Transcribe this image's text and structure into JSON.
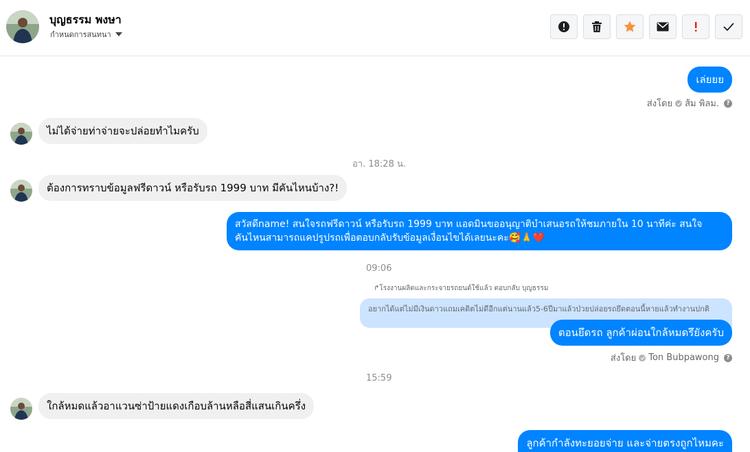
{
  "header": {
    "contact_name": "บุญธรรม พงษา",
    "subtitle": "กำหนดการสนทนา",
    "actions": [
      {
        "icon": "alert-circle-icon",
        "label": "report"
      },
      {
        "icon": "trash-icon",
        "label": "delete"
      },
      {
        "icon": "star-icon",
        "label": "star"
      },
      {
        "icon": "envelope-icon",
        "label": "mark-unread"
      },
      {
        "icon": "exclamation-icon",
        "label": "important"
      },
      {
        "icon": "checkmark-icon",
        "label": "done"
      }
    ]
  },
  "messages": [
    {
      "dir": "out",
      "text": "เล่ยยย"
    },
    {
      "sent_by_label": "ส่งโดย",
      "sent_by_name": "ส้ม พิลม."
    },
    {
      "dir": "in",
      "text": "ไม่ได้จ่ายท่าจ่ายจะปล่อยทำไมครับ"
    },
    {
      "timestamp": "อา. 18:28 น."
    },
    {
      "dir": "in",
      "text": "ต้องการทราบข้อมูลฟรีดาวน์ หรือรับรถ 1999 บาท มีคันไหนบ้าง?!"
    },
    {
      "dir": "out",
      "text_line1": "สวัสดีname! สนใจรถฟรีดาวน์ หรือรับรถ 1999 บาท แอดมินขออนุญาติบำเสนอรถให้ชมภายใน 10 นาทีค่ะ สนใจ",
      "text_line2": "คันไหนสามารถแคปรูปรถเพื่อตอบกลับรับข้อมูลเงื่อนไขได้เลยนะคะ🥰🙏❤️"
    },
    {
      "timestamp": "09:06"
    },
    {
      "reply_note": "↱โรงงานผลิตและกระจายรถยนต์ใช้แล้ว ตอบกลับ บุญธรรม"
    },
    {
      "quoted": "อยากได้แต่ไม่มีเงินดาวแถมเคดิตไม่ดีอีกแต่นานแล้ว5-6ปีมาแล้วป่วยปล่อยรถยึดตอนนี้หายแล้วทำงานปกติ"
    },
    {
      "dir": "out",
      "text": "ตอนยึดรถ ลูกค้าผ่อนใกล้หมดรึยังครับ"
    },
    {
      "sent_by_label": "ส่งโดย",
      "sent_by_name": "Ton Bubpawong"
    },
    {
      "timestamp": "15:59"
    },
    {
      "dir": "in",
      "text": "ใกล้หมดแล้วอาแวนซ่าป้ายแดงเกือบล้านหลือสี่แสนเกินครึ่ง"
    },
    {
      "dir": "out",
      "text": "ลูกค้ากำลังทะยอยจ่าย และจ่ายตรงถูกไหมคะ"
    }
  ],
  "colors": {
    "outgoing_bubble": "#0084ff",
    "incoming_bubble": "#f0f0f0",
    "quoted_bubble": "#cce4ff",
    "star": "#f7923a",
    "exclamation": "#e02020"
  }
}
